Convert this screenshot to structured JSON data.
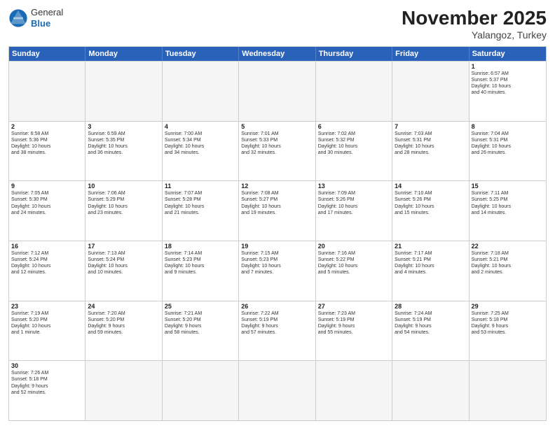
{
  "header": {
    "logo_general": "General",
    "logo_blue": "Blue",
    "month_year": "November 2025",
    "location": "Yalangoz, Turkey"
  },
  "weekdays": [
    "Sunday",
    "Monday",
    "Tuesday",
    "Wednesday",
    "Thursday",
    "Friday",
    "Saturday"
  ],
  "rows": [
    [
      {
        "day": "",
        "text": "",
        "empty": true
      },
      {
        "day": "",
        "text": "",
        "empty": true
      },
      {
        "day": "",
        "text": "",
        "empty": true
      },
      {
        "day": "",
        "text": "",
        "empty": true
      },
      {
        "day": "",
        "text": "",
        "empty": true
      },
      {
        "day": "",
        "text": "",
        "empty": true
      },
      {
        "day": "1",
        "text": "Sunrise: 6:57 AM\nSunset: 5:37 PM\nDaylight: 10 hours\nand 40 minutes.",
        "empty": false
      }
    ],
    [
      {
        "day": "2",
        "text": "Sunrise: 6:58 AM\nSunset: 5:36 PM\nDaylight: 10 hours\nand 38 minutes.",
        "empty": false
      },
      {
        "day": "3",
        "text": "Sunrise: 6:59 AM\nSunset: 5:35 PM\nDaylight: 10 hours\nand 36 minutes.",
        "empty": false
      },
      {
        "day": "4",
        "text": "Sunrise: 7:00 AM\nSunset: 5:34 PM\nDaylight: 10 hours\nand 34 minutes.",
        "empty": false
      },
      {
        "day": "5",
        "text": "Sunrise: 7:01 AM\nSunset: 5:33 PM\nDaylight: 10 hours\nand 32 minutes.",
        "empty": false
      },
      {
        "day": "6",
        "text": "Sunrise: 7:02 AM\nSunset: 5:32 PM\nDaylight: 10 hours\nand 30 minutes.",
        "empty": false
      },
      {
        "day": "7",
        "text": "Sunrise: 7:03 AM\nSunset: 5:31 PM\nDaylight: 10 hours\nand 28 minutes.",
        "empty": false
      },
      {
        "day": "8",
        "text": "Sunrise: 7:04 AM\nSunset: 5:31 PM\nDaylight: 10 hours\nand 26 minutes.",
        "empty": false
      }
    ],
    [
      {
        "day": "9",
        "text": "Sunrise: 7:05 AM\nSunset: 5:30 PM\nDaylight: 10 hours\nand 24 minutes.",
        "empty": false
      },
      {
        "day": "10",
        "text": "Sunrise: 7:06 AM\nSunset: 5:29 PM\nDaylight: 10 hours\nand 23 minutes.",
        "empty": false
      },
      {
        "day": "11",
        "text": "Sunrise: 7:07 AM\nSunset: 5:28 PM\nDaylight: 10 hours\nand 21 minutes.",
        "empty": false
      },
      {
        "day": "12",
        "text": "Sunrise: 7:08 AM\nSunset: 5:27 PM\nDaylight: 10 hours\nand 19 minutes.",
        "empty": false
      },
      {
        "day": "13",
        "text": "Sunrise: 7:09 AM\nSunset: 5:26 PM\nDaylight: 10 hours\nand 17 minutes.",
        "empty": false
      },
      {
        "day": "14",
        "text": "Sunrise: 7:10 AM\nSunset: 5:26 PM\nDaylight: 10 hours\nand 15 minutes.",
        "empty": false
      },
      {
        "day": "15",
        "text": "Sunrise: 7:11 AM\nSunset: 5:25 PM\nDaylight: 10 hours\nand 14 minutes.",
        "empty": false
      }
    ],
    [
      {
        "day": "16",
        "text": "Sunrise: 7:12 AM\nSunset: 5:24 PM\nDaylight: 10 hours\nand 12 minutes.",
        "empty": false
      },
      {
        "day": "17",
        "text": "Sunrise: 7:13 AM\nSunset: 5:24 PM\nDaylight: 10 hours\nand 10 minutes.",
        "empty": false
      },
      {
        "day": "18",
        "text": "Sunrise: 7:14 AM\nSunset: 5:23 PM\nDaylight: 10 hours\nand 9 minutes.",
        "empty": false
      },
      {
        "day": "19",
        "text": "Sunrise: 7:15 AM\nSunset: 5:23 PM\nDaylight: 10 hours\nand 7 minutes.",
        "empty": false
      },
      {
        "day": "20",
        "text": "Sunrise: 7:16 AM\nSunset: 5:22 PM\nDaylight: 10 hours\nand 5 minutes.",
        "empty": false
      },
      {
        "day": "21",
        "text": "Sunrise: 7:17 AM\nSunset: 5:21 PM\nDaylight: 10 hours\nand 4 minutes.",
        "empty": false
      },
      {
        "day": "22",
        "text": "Sunrise: 7:18 AM\nSunset: 5:21 PM\nDaylight: 10 hours\nand 2 minutes.",
        "empty": false
      }
    ],
    [
      {
        "day": "23",
        "text": "Sunrise: 7:19 AM\nSunset: 5:20 PM\nDaylight: 10 hours\nand 1 minute.",
        "empty": false
      },
      {
        "day": "24",
        "text": "Sunrise: 7:20 AM\nSunset: 5:20 PM\nDaylight: 9 hours\nand 59 minutes.",
        "empty": false
      },
      {
        "day": "25",
        "text": "Sunrise: 7:21 AM\nSunset: 5:20 PM\nDaylight: 9 hours\nand 58 minutes.",
        "empty": false
      },
      {
        "day": "26",
        "text": "Sunrise: 7:22 AM\nSunset: 5:19 PM\nDaylight: 9 hours\nand 57 minutes.",
        "empty": false
      },
      {
        "day": "27",
        "text": "Sunrise: 7:23 AM\nSunset: 5:19 PM\nDaylight: 9 hours\nand 55 minutes.",
        "empty": false
      },
      {
        "day": "28",
        "text": "Sunrise: 7:24 AM\nSunset: 5:19 PM\nDaylight: 9 hours\nand 54 minutes.",
        "empty": false
      },
      {
        "day": "29",
        "text": "Sunrise: 7:25 AM\nSunset: 5:18 PM\nDaylight: 9 hours\nand 53 minutes.",
        "empty": false
      }
    ],
    [
      {
        "day": "30",
        "text": "Sunrise: 7:26 AM\nSunset: 5:18 PM\nDaylight: 9 hours\nand 52 minutes.",
        "empty": false
      },
      {
        "day": "",
        "text": "",
        "empty": true
      },
      {
        "day": "",
        "text": "",
        "empty": true
      },
      {
        "day": "",
        "text": "",
        "empty": true
      },
      {
        "day": "",
        "text": "",
        "empty": true
      },
      {
        "day": "",
        "text": "",
        "empty": true
      },
      {
        "day": "",
        "text": "",
        "empty": true
      }
    ]
  ]
}
